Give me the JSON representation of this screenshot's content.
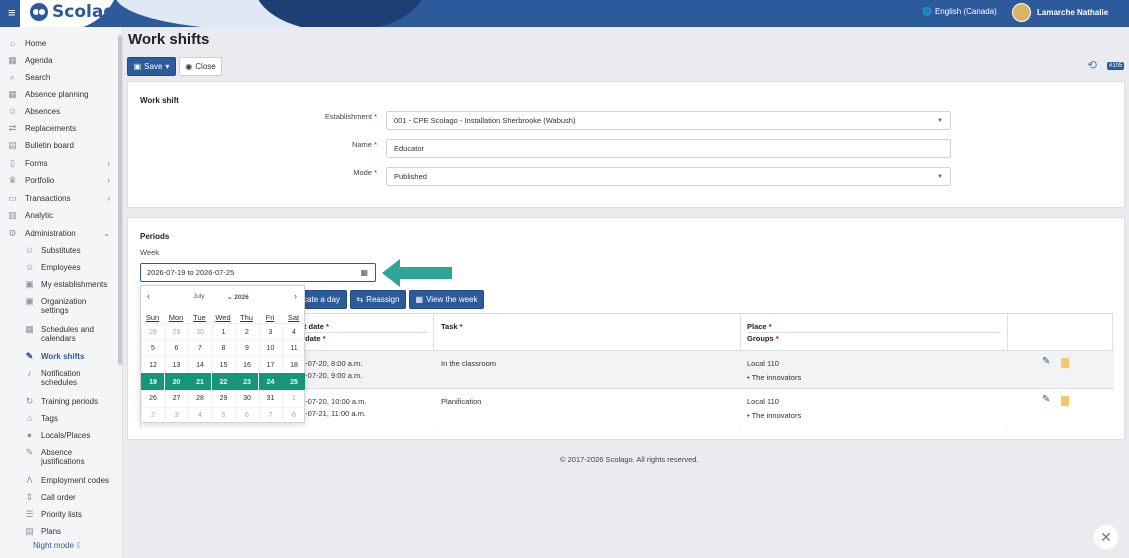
{
  "header": {
    "brand": "Scolago",
    "language": "English (Canada)",
    "user_name": "Lamarche Nathalie"
  },
  "sidebar": {
    "items": [
      {
        "label": "Home",
        "icon": "home-icon"
      },
      {
        "label": "Agenda",
        "icon": "calendar-icon"
      },
      {
        "label": "Search",
        "icon": "search-icon"
      },
      {
        "label": "Absence planning",
        "icon": "calendar-icon"
      },
      {
        "label": "Absences",
        "icon": "user-icon"
      },
      {
        "label": "Replacements",
        "icon": "swap-icon"
      },
      {
        "label": "Bulletin board",
        "icon": "board-icon"
      },
      {
        "label": "Forms",
        "icon": "file-icon"
      },
      {
        "label": "Portfolio",
        "icon": "trophy-icon"
      },
      {
        "label": "Transactions",
        "icon": "card-icon"
      },
      {
        "label": "Analytic",
        "icon": "chart-icon"
      },
      {
        "label": "Administration",
        "icon": "gear-icon"
      }
    ],
    "sub_items": [
      {
        "label": "Substitutes"
      },
      {
        "label": "Employees"
      },
      {
        "label": "My establishments"
      },
      {
        "label": "Organization settings"
      },
      {
        "label": "Schedules and calendars"
      },
      {
        "label": "Work shifts"
      },
      {
        "label": "Notification schedules"
      },
      {
        "label": "Training periods"
      },
      {
        "label": "Tags"
      },
      {
        "label": "Locals/Places"
      },
      {
        "label": "Absence justifications"
      },
      {
        "label": "Employment codes"
      },
      {
        "label": "Call order"
      },
      {
        "label": "Priority lists"
      },
      {
        "label": "Plans"
      }
    ],
    "night_mode": "Night mode"
  },
  "page": {
    "title": "Work shifts",
    "save": "Save",
    "close": "Close",
    "badge": "#105"
  },
  "workshift": {
    "section_title": "Work shift",
    "establishment_label": "Establishment",
    "establishment_value": "001 - CPE Scolago - Installation Sherbrooke (Wabush)",
    "name_label": "Name",
    "name_value": "Educator",
    "mode_label": "Mode",
    "mode_value": "Published"
  },
  "periods": {
    "section_title": "Periods",
    "week_label": "Week",
    "week_value": "2026-07-19 to 2026-07-25",
    "btn_allocate": "cate a day",
    "btn_reassign": "Reassign",
    "btn_view_week": "View the week",
    "headers": {
      "start": "rt date",
      "end": "l date",
      "task": "Task",
      "place": "Place",
      "groups": "Groups"
    },
    "rows": [
      {
        "start": "6-07-20, 8:00 a.m.",
        "end": "6-07-20, 9:00 a.m.",
        "task": "In the classroom",
        "place": "Local 110",
        "group": "The innovators"
      },
      {
        "start": "6-07-20, 10:00 a.m.",
        "end": "6-07-21, 11:00 a.m.",
        "task": "Planification",
        "place": "Local 110",
        "group": "The innovators"
      }
    ]
  },
  "calendar": {
    "month": "July",
    "year": "2026",
    "prev": "‹",
    "next": "›",
    "dow": [
      "Sun",
      "Mon",
      "Tue",
      "Wed",
      "Thu",
      "Fri",
      "Sat"
    ],
    "weeks": [
      [
        "28",
        "29",
        "30",
        "1",
        "2",
        "3",
        "4"
      ],
      [
        "5",
        "6",
        "7",
        "8",
        "9",
        "10",
        "11"
      ],
      [
        "12",
        "13",
        "14",
        "15",
        "16",
        "17",
        "18"
      ],
      [
        "19",
        "20",
        "21",
        "22",
        "23",
        "24",
        "25"
      ],
      [
        "26",
        "27",
        "28",
        "29",
        "30",
        "31",
        "1"
      ],
      [
        "2",
        "3",
        "4",
        "5",
        "6",
        "7",
        "8"
      ]
    ]
  },
  "footer": "© 2017-2026 Scolago. All rights reserved.",
  "colors": {
    "primary": "#2d5a9b",
    "selected_week": "#15957a",
    "arrow": "#2fa597"
  }
}
